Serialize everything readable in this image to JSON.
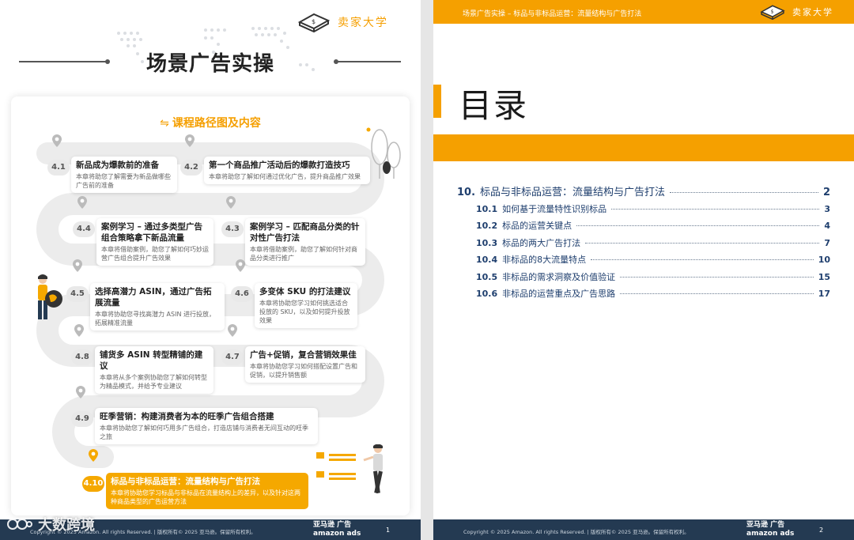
{
  "left_page": {
    "brand": "卖家大学",
    "title": "场景广告实操",
    "roadmap_title": "课程路径图及内容",
    "steps": [
      {
        "num": "4.1",
        "title": "新品成为爆款前的准备",
        "desc": "本章将助您了解需要为新品做哪些广告前的准备"
      },
      {
        "num": "4.2",
        "title": "第一个商品推广活动后的爆款打造技巧",
        "desc": "本章将助您了解如何通过优化广告，提升商品推广效果"
      },
      {
        "num": "4.4",
        "title": "案例学习 – 通过多类型广告组合策略拿下新品流量",
        "desc": "本章将借助案例，助您了解如何巧妙运营广告组合提升广告效果"
      },
      {
        "num": "4.3",
        "title": "案例学习 – 匹配商品分类的针对性广告打法",
        "desc": "本章将借助案例，助您了解如何针对商品分类进行推广"
      },
      {
        "num": "4.5",
        "title": "选择高潜力 ASIN，通过广告拓展流量",
        "desc": "本章将协助您寻找高潜力 ASIN 进行投放，拓展精准流量"
      },
      {
        "num": "4.6",
        "title": "多变体 SKU 的打法建议",
        "desc": "本章将协助您学习如何挑选适合投放的 SKU，以及如何提升投放效果"
      },
      {
        "num": "4.8",
        "title": "铺货多 ASIN 转型精铺的建议",
        "desc": "本章将从多个案例协助您了解如何转型为精品模式，并给予专业建议"
      },
      {
        "num": "4.7",
        "title": "广告+促销，复合营销效果佳",
        "desc": "本章将协助您学习如何搭配设置广告和促销，以提升销售额"
      },
      {
        "num": "4.9",
        "title": "旺季营销：构建消费者为本的旺季广告组合搭建",
        "desc": "本章将协助您了解如何巧用多广告组合，打造店铺与消费者无间互动的旺季之旅"
      },
      {
        "num": "4.10",
        "title": "标品与非标品运营：流量结构与广告打法",
        "desc": "本章将协助您学习标品与非标品在流量结构上的差异，以及针对这两种商品类型的广告运营方法"
      }
    ],
    "footer": {
      "copyright": "Copyright © 2025 Amazon. All rights Reserved. | 版权所有© 2025 亚马逊。保留所有权利。",
      "logo_top": "亚马逊 广告",
      "logo_bottom": "amazon ads",
      "page": "1"
    }
  },
  "right_page": {
    "header": "场景广告实操 – 标品与非标品运营：流量结构与广告打法",
    "brand": "卖家大学",
    "toc_title": "目录",
    "toc_main": {
      "num": "10.",
      "title": "标品与非标品运营：流量结构与广告打法",
      "page": "2"
    },
    "toc_items": [
      {
        "num": "10.1",
        "title": "如何基于流量特性识别标品",
        "page": "3"
      },
      {
        "num": "10.2",
        "title": "标品的运营关键点",
        "page": "4"
      },
      {
        "num": "10.3",
        "title": "标品的两大广告打法",
        "page": "7"
      },
      {
        "num": "10.4",
        "title": "非标品的8大流量特点",
        "page": "10"
      },
      {
        "num": "10.5",
        "title": "非标品的需求洞察及价值验证",
        "page": "15"
      },
      {
        "num": "10.6",
        "title": "非标品的运营重点及广告思路",
        "page": "17"
      }
    ],
    "footer": {
      "copyright": "Copyright © 2025 Amazon. All rights Reserved. | 版权所有© 2025 亚马逊。保留所有权利。",
      "logo_top": "亚马逊 广告",
      "logo_bottom": "amazon ads",
      "page": "2"
    }
  },
  "watermark": "大数跨境",
  "colors": {
    "accent": "#f5a000",
    "navy": "#243a52",
    "toc_text": "#1f3f6e"
  }
}
